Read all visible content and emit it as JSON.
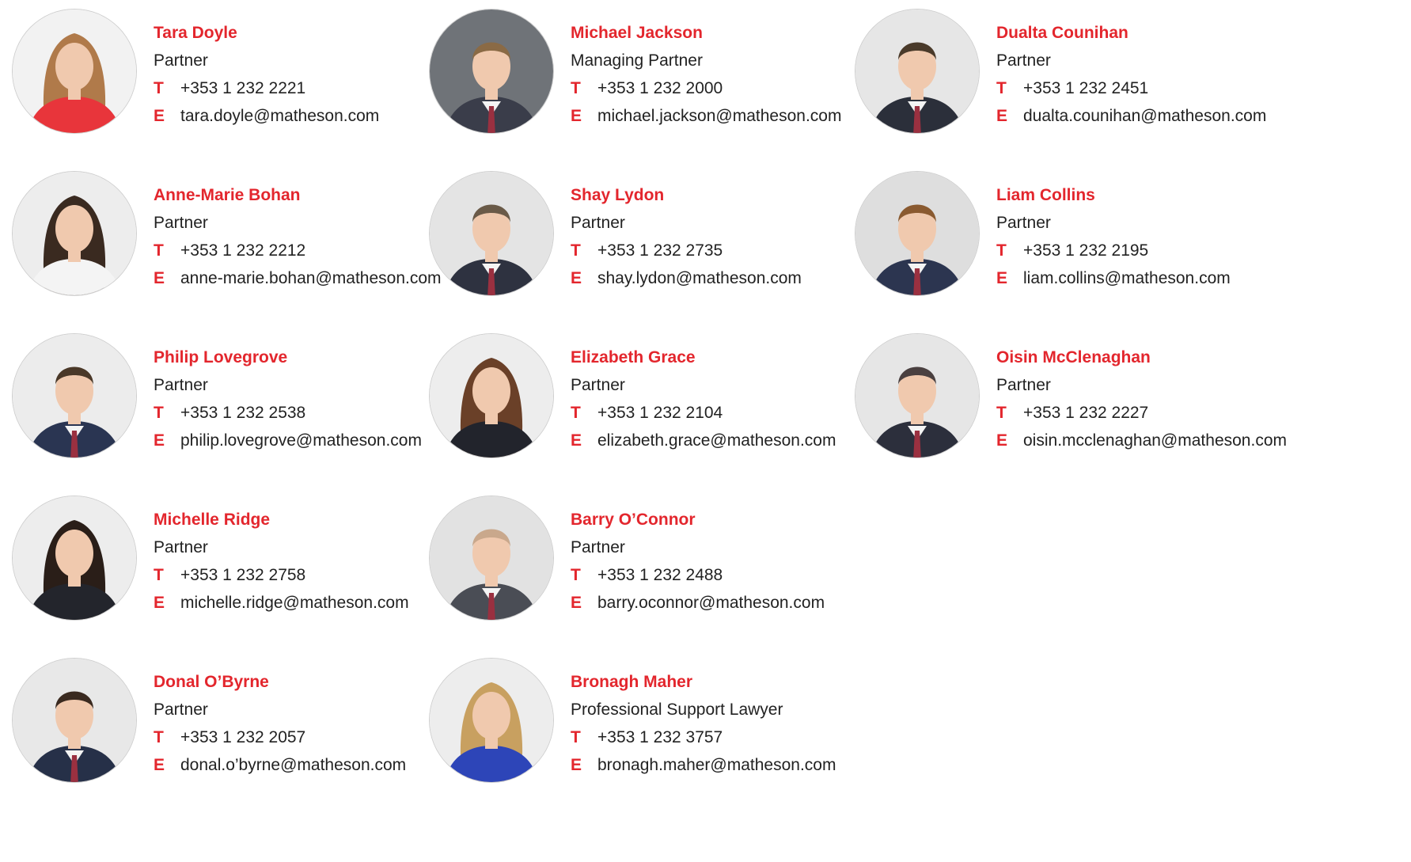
{
  "directory": {
    "people": [
      {
        "name": "Tara Doyle",
        "role": "Partner",
        "phone_label": "T",
        "phone": "+353 1 232 2221",
        "email_label": "E",
        "email": "tara.doyle@matheson.com",
        "photo": "portrait-woman",
        "top_color": "#e8353b",
        "bg_color": "#f2f2f2",
        "hair_color": "#b07a4a"
      },
      {
        "name": "Michael Jackson",
        "role": "Managing Partner",
        "phone_label": "T",
        "phone": "+353 1 232 2000",
        "email_label": "E",
        "email": "michael.jackson@matheson.com",
        "photo": "portrait-man",
        "top_color": "#3a3d4a",
        "bg_color": "#6f7378",
        "hair_color": "#8a6a45"
      },
      {
        "name": "Dualta Counihan",
        "role": "Partner",
        "phone_label": "T",
        "phone": "+353 1 232 2451",
        "email_label": "E",
        "email": "dualta.counihan@matheson.com",
        "photo": "portrait-man",
        "top_color": "#2b2f3a",
        "bg_color": "#e6e6e6",
        "hair_color": "#4a3a2a"
      },
      {
        "name": "Anne-Marie Bohan",
        "role": "Partner",
        "phone_label": "T",
        "phone": "+353 1 232 2212",
        "email_label": "E",
        "email": "anne-marie.bohan@matheson.com",
        "photo": "portrait-woman",
        "top_color": "#f4f4f4",
        "bg_color": "#ededed",
        "hair_color": "#3a2a20"
      },
      {
        "name": "Shay Lydon",
        "role": "Partner",
        "phone_label": "T",
        "phone": "+353 1 232 2735",
        "email_label": "E",
        "email": "shay.lydon@matheson.com",
        "photo": "portrait-man",
        "top_color": "#2e3240",
        "bg_color": "#e4e4e4",
        "hair_color": "#6a5a48"
      },
      {
        "name": "Liam Collins",
        "role": "Partner",
        "phone_label": "T",
        "phone": "+353 1 232 2195",
        "email_label": "E",
        "email": "liam.collins@matheson.com",
        "photo": "portrait-man",
        "top_color": "#2c3550",
        "bg_color": "#dedede",
        "hair_color": "#8a5a30"
      },
      {
        "name": "Philip Lovegrove",
        "role": "Partner",
        "phone_label": "T",
        "phone": "+353 1 232 2538",
        "email_label": "E",
        "email": "philip.lovegrove@matheson.com",
        "photo": "portrait-man",
        "top_color": "#2a3552",
        "bg_color": "#ececec",
        "hair_color": "#4a3828"
      },
      {
        "name": "Elizabeth Grace",
        "role": "Partner",
        "phone_label": "T",
        "phone": "+353 1 232 2104",
        "email_label": "E",
        "email": "elizabeth.grace@matheson.com",
        "photo": "portrait-woman",
        "top_color": "#22242c",
        "bg_color": "#ededed",
        "hair_color": "#6a4028"
      },
      {
        "name": "Oisin McClenaghan",
        "role": "Partner",
        "phone_label": "T",
        "phone": "+353 1 232 2227",
        "email_label": "E",
        "email": "oisin.mcclenaghan@matheson.com",
        "photo": "portrait-man",
        "top_color": "#2c2f3c",
        "bg_color": "#e6e6e6",
        "hair_color": "#4a4040"
      },
      {
        "name": "Michelle Ridge",
        "role": "Partner",
        "phone_label": "T",
        "phone": "+353 1 232 2758",
        "email_label": "E",
        "email": "michelle.ridge@matheson.com",
        "photo": "portrait-woman",
        "top_color": "#23252c",
        "bg_color": "#ededed",
        "hair_color": "#2a1e18"
      },
      {
        "name": "Barry O’Connor",
        "role": "Partner",
        "phone_label": "T",
        "phone": "+353 1 232 2488",
        "email_label": "E",
        "email": "barry.oconnor@matheson.com",
        "photo": "portrait-man",
        "top_color": "#4a4d55",
        "bg_color": "#e2e2e2",
        "hair_color": "#c9a88c"
      },
      {
        "name": "Donal O’Byrne",
        "role": "Partner",
        "phone_label": "T",
        "phone": "+353 1 232 2057",
        "email_label": "E",
        "email": "donal.o’byrne@matheson.com",
        "photo": "portrait-man",
        "top_color": "#263048",
        "bg_color": "#e8e8e8",
        "hair_color": "#3a2a20"
      },
      {
        "name": "Bronagh Maher",
        "role": "Professional Support Lawyer",
        "phone_label": "T",
        "phone": "+353 1 232 3757",
        "email_label": "E",
        "email": "bronagh.maher@matheson.com",
        "photo": "portrait-woman",
        "top_color": "#2d45b8",
        "bg_color": "#ededed",
        "hair_color": "#c8a060"
      }
    ]
  },
  "theme": {
    "accent": "#e3262d",
    "text": "#222222",
    "background": "#ffffff"
  }
}
